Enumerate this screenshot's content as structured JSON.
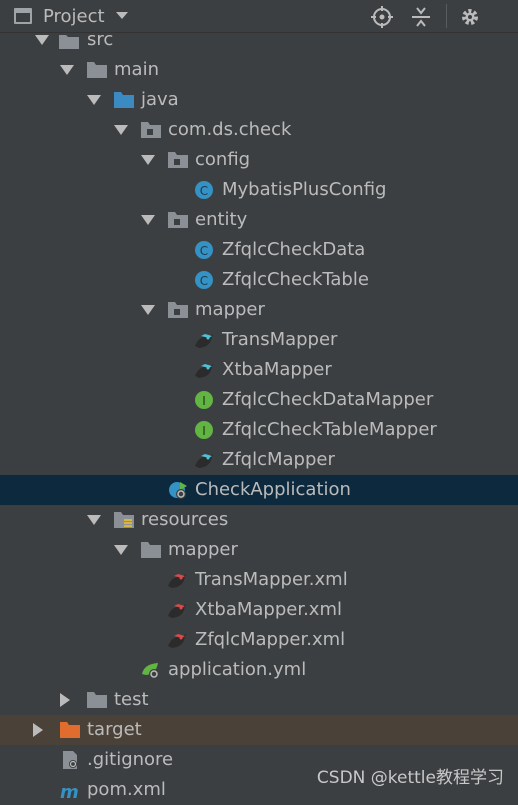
{
  "header": {
    "title": "Project",
    "actions": [
      "locate-icon",
      "collapse-icon",
      "gear-icon"
    ]
  },
  "tree": [
    {
      "label": "src",
      "icon": "folder-icon",
      "expanded": true
    },
    {
      "label": "main",
      "icon": "folder-icon",
      "expanded": true
    },
    {
      "label": "java",
      "icon": "source-folder-icon",
      "expanded": true
    },
    {
      "label": "com.ds.check",
      "icon": "package-icon",
      "expanded": true
    },
    {
      "label": "config",
      "icon": "package-icon",
      "expanded": true
    },
    {
      "label": "MybatisPlusConfig",
      "icon": "class-icon"
    },
    {
      "label": "entity",
      "icon": "package-icon",
      "expanded": true
    },
    {
      "label": "ZfqlcCheckData",
      "icon": "class-icon"
    },
    {
      "label": "ZfqlcCheckTable",
      "icon": "class-icon"
    },
    {
      "label": "mapper",
      "icon": "package-icon",
      "expanded": true
    },
    {
      "label": "TransMapper",
      "icon": "mybatis-mapper-icon"
    },
    {
      "label": "XtbaMapper",
      "icon": "mybatis-mapper-icon"
    },
    {
      "label": "ZfqlcCheckDataMapper",
      "icon": "interface-icon"
    },
    {
      "label": "ZfqlcCheckTableMapper",
      "icon": "interface-icon"
    },
    {
      "label": "ZfqlcMapper",
      "icon": "mybatis-mapper-icon"
    },
    {
      "label": "CheckApplication",
      "icon": "spring-boot-app-icon",
      "selected": true
    },
    {
      "label": "resources",
      "icon": "resources-folder-icon",
      "expanded": true
    },
    {
      "label": "mapper",
      "icon": "folder-icon",
      "expanded": true
    },
    {
      "label": "TransMapper.xml",
      "icon": "mybatis-xml-icon"
    },
    {
      "label": "XtbaMapper.xml",
      "icon": "mybatis-xml-icon"
    },
    {
      "label": "ZfqlcMapper.xml",
      "icon": "mybatis-xml-icon"
    },
    {
      "label": "application.yml",
      "icon": "spring-yml-icon"
    },
    {
      "label": "test",
      "icon": "folder-icon",
      "expanded": false
    },
    {
      "label": "target",
      "icon": "excluded-folder-icon",
      "expanded": false,
      "highlight": true
    },
    {
      "label": ".gitignore",
      "icon": "gitignore-file-icon"
    },
    {
      "label": "pom.xml",
      "icon": "maven-icon"
    }
  ],
  "watermark": "CSDN @kettle教程学习",
  "colors": {
    "background": "#3c3f41",
    "selection": "#0d293e",
    "excluded_highlight": "#4a4238",
    "text": "#bbbbbb",
    "class_icon": "#3592c4",
    "interface_icon": "#62b543",
    "excluded_folder": "#e06c2e"
  }
}
